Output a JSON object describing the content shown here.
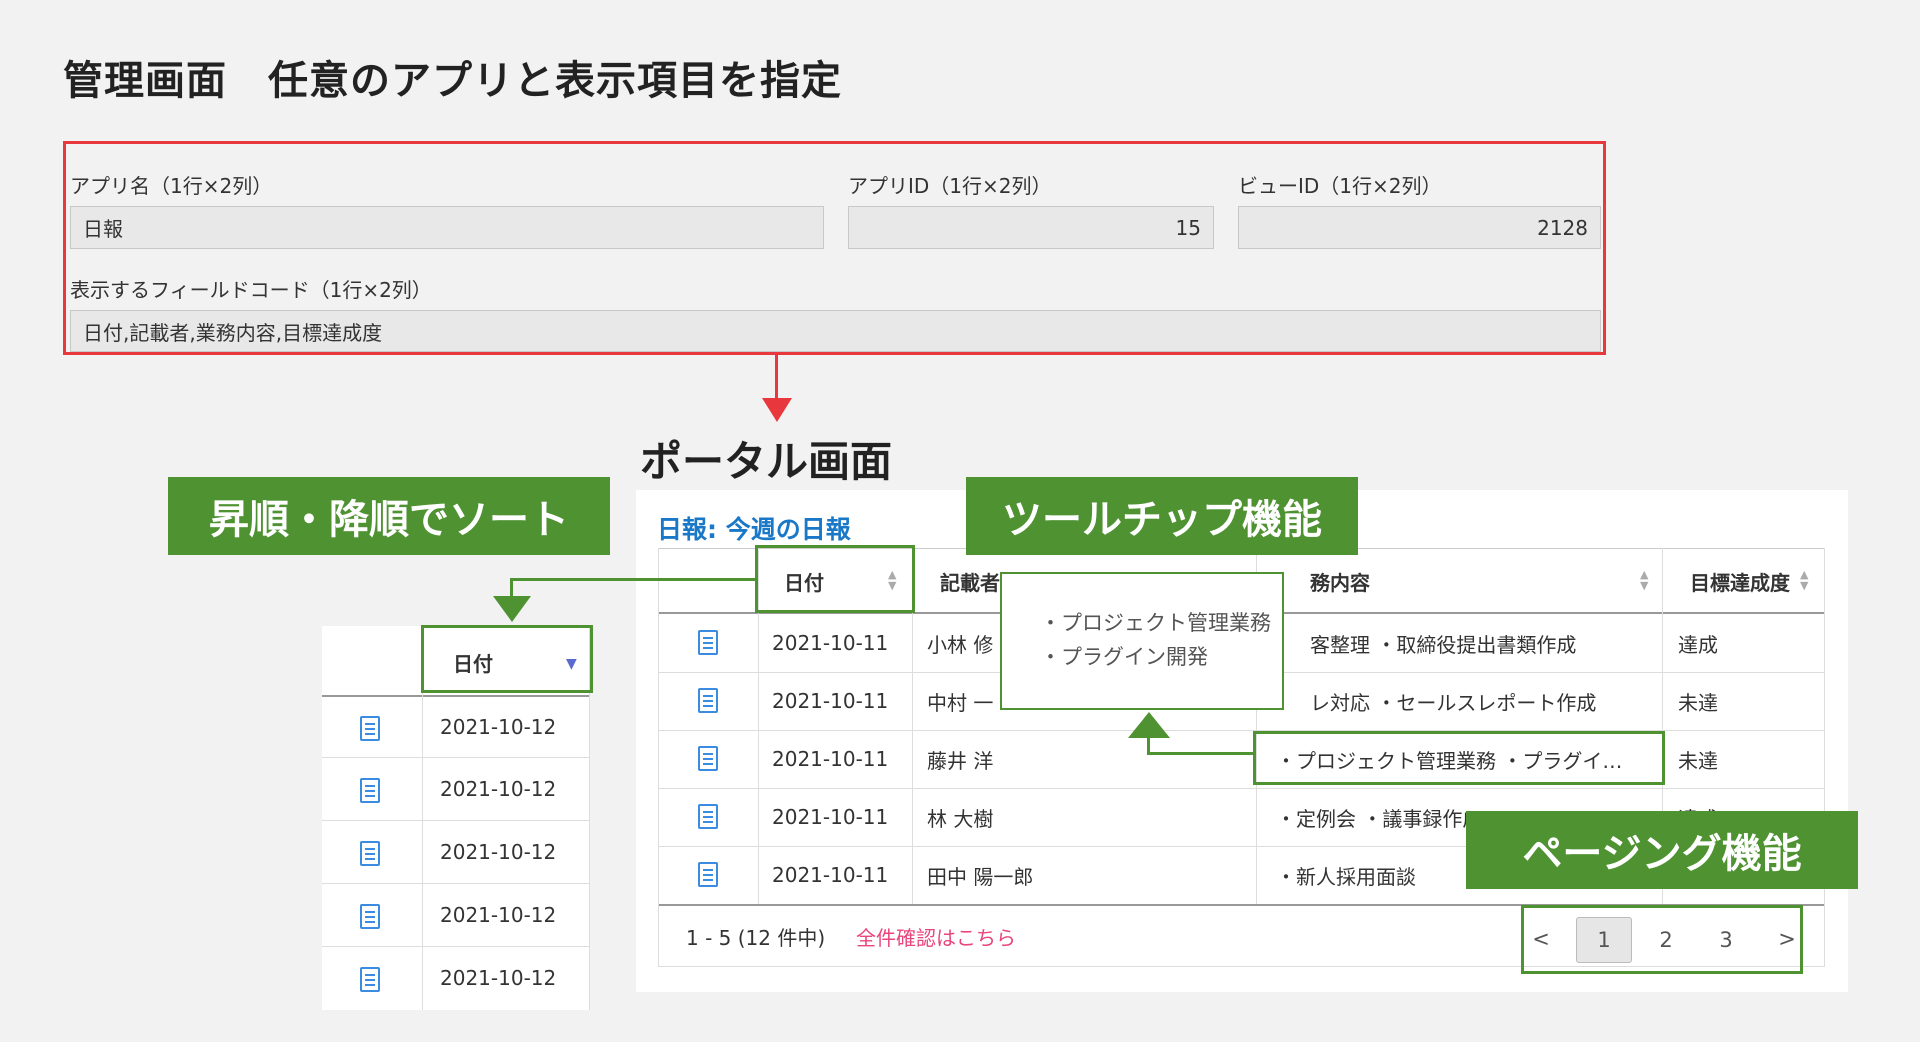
{
  "admin": {
    "title": "管理画面　任意のアプリと表示項目を指定",
    "app_name_label": "アプリ名（1行×2列）",
    "app_name_value": "日報",
    "app_id_label": "アプリID（1行×2列）",
    "app_id_value": "15",
    "view_id_label": "ビューID（1行×2列）",
    "view_id_value": "2128",
    "fields_label": "表示するフィールドコード（1行×2列）",
    "fields_value": "日付,記載者,業務内容,目標達成度"
  },
  "portal": {
    "title": "ポータル画面",
    "subtitle": "日報: 今週の日報",
    "headers": [
      "日付",
      "記載者",
      "業務内容",
      "目標達成度"
    ],
    "header_partial": {
      "writer": "記載者",
      "task": "務内容"
    },
    "rows": [
      {
        "date": "2021-10-11",
        "writer": "小林 修",
        "task": "客整理 ・取締役提出書類作成",
        "achievement": "達成"
      },
      {
        "date": "2021-10-11",
        "writer": "中村 一",
        "task": "レ対応 ・セールスレポート作成",
        "achievement": "未達"
      },
      {
        "date": "2021-10-11",
        "writer": "藤井 洋",
        "task": "・プロジェクト管理業務 ・プラグイ…",
        "achievement": "未達"
      },
      {
        "date": "2021-10-11",
        "writer": "林 大樹",
        "task": "・定例会 ・議事録作成",
        "achievement": "達成"
      },
      {
        "date": "2021-10-11",
        "writer": "田中 陽一郎",
        "task": "・新人採用面談",
        "achievement": ""
      }
    ],
    "tooltip_lines": [
      "・プロジェクト管理業務",
      "・プラグイン開発"
    ],
    "footer_count": "1 - 5 (12 件中)",
    "footer_link": "全件確認はこちら",
    "pager": {
      "prev": "<",
      "pages": [
        "1",
        "2",
        "3"
      ],
      "next": ">",
      "current": "1"
    }
  },
  "labels": {
    "sort": "昇順・降順でソート",
    "tooltip": "ツールチップ機能",
    "paging": "ページング機能"
  },
  "mini_table": {
    "header": "日付",
    "sort_indicator": "▼",
    "rows": [
      "2021-10-12",
      "2021-10-12",
      "2021-10-12",
      "2021-10-12",
      "2021-10-12"
    ]
  },
  "colors": {
    "accent_red": "#e8383d",
    "accent_green": "#4f9232",
    "link_blue": "#1a78c8",
    "link_pink": "#e8467c"
  }
}
